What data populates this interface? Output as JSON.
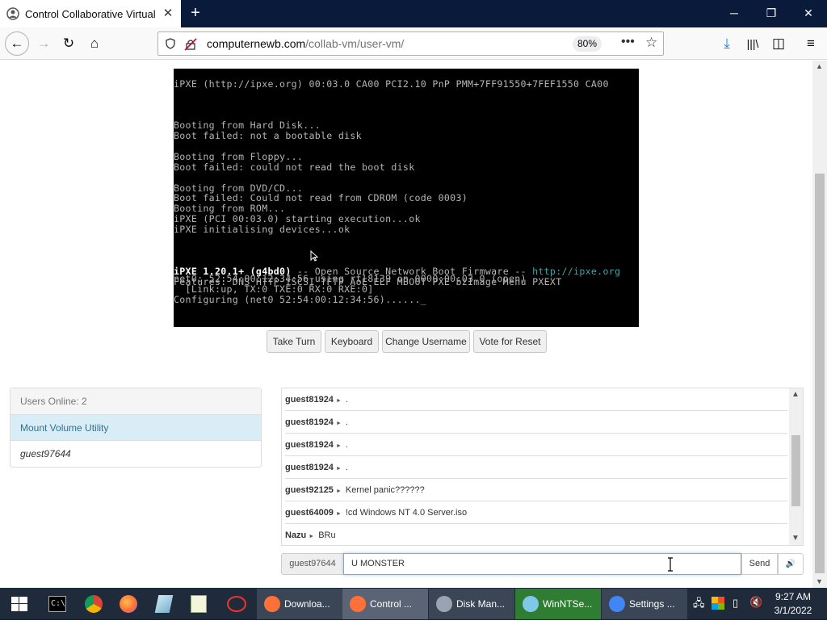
{
  "browser": {
    "tab_title": "Control Collaborative Virtual M",
    "url_domain": "computernewb.com",
    "url_path": "/collab-vm/user-vm/",
    "zoom": "80%"
  },
  "vm_screen": {
    "lines": [
      "iPXE (http://ipxe.org) 00:03.0 CA00 PCI2.10 PnP PMM+7FF91550+7FEF1550 CA00",
      "",
      "",
      "",
      "Booting from Hard Disk...",
      "Boot failed: not a bootable disk",
      "",
      "Booting from Floppy...",
      "Boot failed: could not read the boot disk",
      "",
      "Booting from DVD/CD...",
      "Boot failed: Could not read from CDROM (code 0003)",
      "Booting from ROM...",
      "iPXE (PCI 00:03.0) starting execution...ok",
      "iPXE initialising devices...ok",
      "",
      "",
      "",
      "net0: 52:54:00:12:34:56 using rtl8139 on 0000:00:03.0 (open)",
      "  [Link:up, TX:0 TXE:0 RX:0 RXE:0]",
      "Configuring (net0 52:54:00:12:34:56)......_"
    ],
    "banner_bright": "iPXE 1.20.1+ (g4bd0)",
    "banner_rest": " -- Open Source Network Boot Firmware -- ",
    "banner_link": "http://ipxe.org",
    "features": "Features: DNS HTTP iSCSI TFTP AoE ELF MBOOT PXE bzImage Menu PXEXT"
  },
  "vm_buttons": {
    "take_turn": "Take Turn",
    "keyboard": "Keyboard",
    "change_username": "Change Username",
    "vote_reset": "Vote for Reset"
  },
  "users": {
    "header": "Users Online: 2",
    "list": [
      "Mount Volume Utility",
      "guest97644"
    ]
  },
  "chat": {
    "messages": [
      {
        "user": "guest81924",
        "text": "."
      },
      {
        "user": "guest81924",
        "text": "."
      },
      {
        "user": "guest81924",
        "text": "."
      },
      {
        "user": "guest81924",
        "text": "."
      },
      {
        "user": "guest92125",
        "text": "Kernel panic??????"
      },
      {
        "user": "guest64009",
        "text": "!cd Windows NT 4.0 Server.iso"
      },
      {
        "user": "Nazu",
        "text": "BRu"
      }
    ],
    "username": "guest97644",
    "input_value": "U MONSTER",
    "send_label": "Send"
  },
  "taskbar": {
    "windows": [
      {
        "label": "Downloa...",
        "color": "#ff7139"
      },
      {
        "label": "Control ...",
        "color": "#ff7139"
      },
      {
        "label": "Disk Man...",
        "color": "#9aa4b0"
      },
      {
        "label": "WinNTSe...",
        "color": "#7fc8e8"
      },
      {
        "label": "Settings ...",
        "color": "#4285f4"
      }
    ],
    "time": "9:27 AM",
    "date": "3/1/2022"
  }
}
